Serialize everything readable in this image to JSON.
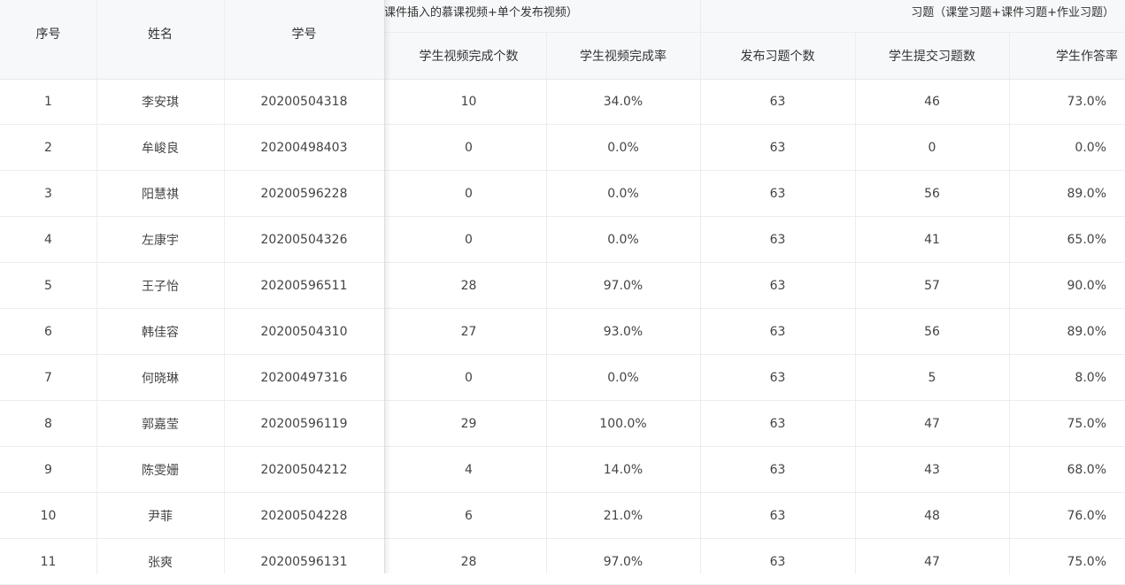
{
  "header": {
    "col_index": "序号",
    "col_name": "姓名",
    "col_id": "学号",
    "group_video": "课件插入的慕课视频+单个发布视频）",
    "group_exercise": "习题（课堂习题+课件习题+作业习题）",
    "col_video_count": "学生视频完成个数",
    "col_video_rate": "学生视频完成率",
    "col_publish_count": "发布习题个数",
    "col_submit_count": "学生提交习题数",
    "col_answer_rate": "学生作答率"
  },
  "rows": [
    {
      "index": "1",
      "name": "李安琪",
      "id": "20200504318",
      "video_count": "10",
      "video_rate": "34.0%",
      "publish": "63",
      "submit": "46",
      "answer_rate": "73.0%"
    },
    {
      "index": "2",
      "name": "牟峻良",
      "id": "20200498403",
      "video_count": "0",
      "video_rate": "0.0%",
      "publish": "63",
      "submit": "0",
      "answer_rate": "0.0%"
    },
    {
      "index": "3",
      "name": "阳慧祺",
      "id": "20200596228",
      "video_count": "0",
      "video_rate": "0.0%",
      "publish": "63",
      "submit": "56",
      "answer_rate": "89.0%"
    },
    {
      "index": "4",
      "name": "左康宇",
      "id": "20200504326",
      "video_count": "0",
      "video_rate": "0.0%",
      "publish": "63",
      "submit": "41",
      "answer_rate": "65.0%"
    },
    {
      "index": "5",
      "name": "王子怡",
      "id": "20200596511",
      "video_count": "28",
      "video_rate": "97.0%",
      "publish": "63",
      "submit": "57",
      "answer_rate": "90.0%"
    },
    {
      "index": "6",
      "name": "韩佳容",
      "id": "20200504310",
      "video_count": "27",
      "video_rate": "93.0%",
      "publish": "63",
      "submit": "56",
      "answer_rate": "89.0%"
    },
    {
      "index": "7",
      "name": "何晓琳",
      "id": "20200497316",
      "video_count": "0",
      "video_rate": "0.0%",
      "publish": "63",
      "submit": "5",
      "answer_rate": "8.0%"
    },
    {
      "index": "8",
      "name": "郭嘉莹",
      "id": "20200596119",
      "video_count": "29",
      "video_rate": "100.0%",
      "publish": "63",
      "submit": "47",
      "answer_rate": "75.0%"
    },
    {
      "index": "9",
      "name": "陈雯姗",
      "id": "20200504212",
      "video_count": "4",
      "video_rate": "14.0%",
      "publish": "63",
      "submit": "43",
      "answer_rate": "68.0%"
    },
    {
      "index": "10",
      "name": "尹菲",
      "id": "20200504228",
      "video_count": "6",
      "video_rate": "21.0%",
      "publish": "63",
      "submit": "48",
      "answer_rate": "76.0%"
    },
    {
      "index": "11",
      "name": "张爽",
      "id": "20200596131",
      "video_count": "28",
      "video_rate": "97.0%",
      "publish": "63",
      "submit": "47",
      "answer_rate": "75.0%"
    }
  ]
}
